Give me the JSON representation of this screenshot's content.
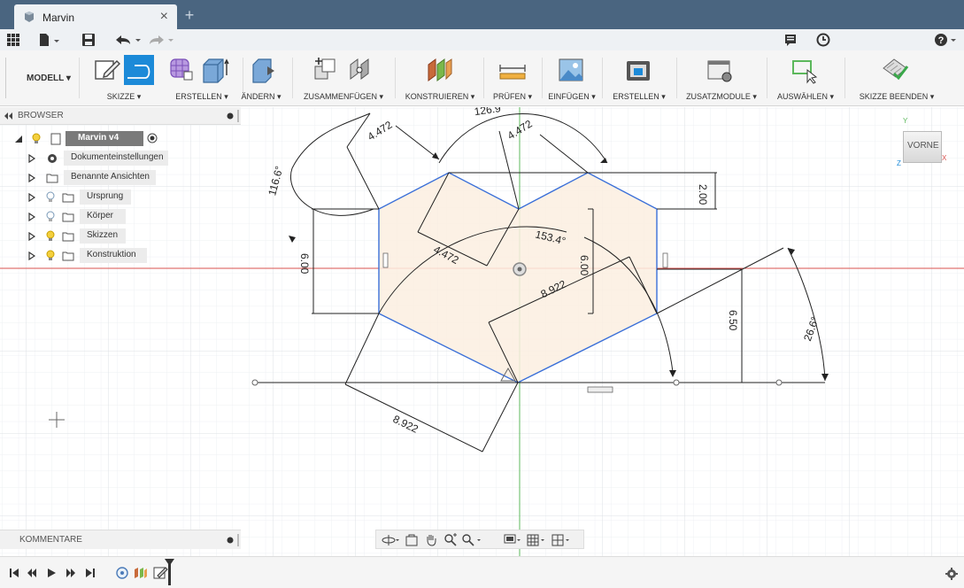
{
  "window": {
    "tab_title": "Marvin",
    "close_symbol": "×",
    "new_tab_symbol": "+"
  },
  "ribbon": {
    "workspace": "MODELL ▾",
    "groups": [
      {
        "label": "SKIZZE ▾"
      },
      {
        "label": "ERSTELLEN ▾"
      },
      {
        "label": "ÄNDERN ▾"
      },
      {
        "label": "ZUSAMMENFÜGEN ▾"
      },
      {
        "label": "KONSTRUIEREN ▾"
      },
      {
        "label": "PRÜFEN ▾"
      },
      {
        "label": "EINFÜGEN ▾"
      },
      {
        "label": "ERSTELLEN ▾"
      },
      {
        "label": "ZUSATZMODULE ▾"
      },
      {
        "label": "AUSWÄHLEN ▾"
      },
      {
        "label": "SKIZZE BEENDEN ▾"
      }
    ]
  },
  "browser": {
    "title": "BROWSER",
    "root": "Marvin v4",
    "items": [
      {
        "label": "Dokumenteinstellungen"
      },
      {
        "label": "Benannte Ansichten"
      },
      {
        "label": "Ursprung"
      },
      {
        "label": "Körper"
      },
      {
        "label": "Skizzen"
      },
      {
        "label": "Konstruktion"
      }
    ]
  },
  "comments": {
    "title": "KOMMENTARE"
  },
  "viewcube": {
    "face": "VORNE",
    "axis_y": "Y",
    "axis_x": "X",
    "axis_z": "Z"
  },
  "dimensions": {
    "d1": "4.472",
    "d2": "4.472",
    "d3": "126.9",
    "d4": "116.6°",
    "d5": "2.00",
    "d6": "6.00",
    "d7": "6.00",
    "d8": "4.472",
    "d9": "153.4°",
    "d10": "8.922",
    "d11": "6.50",
    "d12": "26.6°",
    "d13": "8.922"
  },
  "colors": {
    "titlebar": "#4a6580",
    "selected_tool": "#1c8ad8",
    "sketch_line": "#3a6fd8",
    "profile_fill": "#fbeee0",
    "axis_red": "#d9534f",
    "axis_green": "#5cb85c"
  }
}
